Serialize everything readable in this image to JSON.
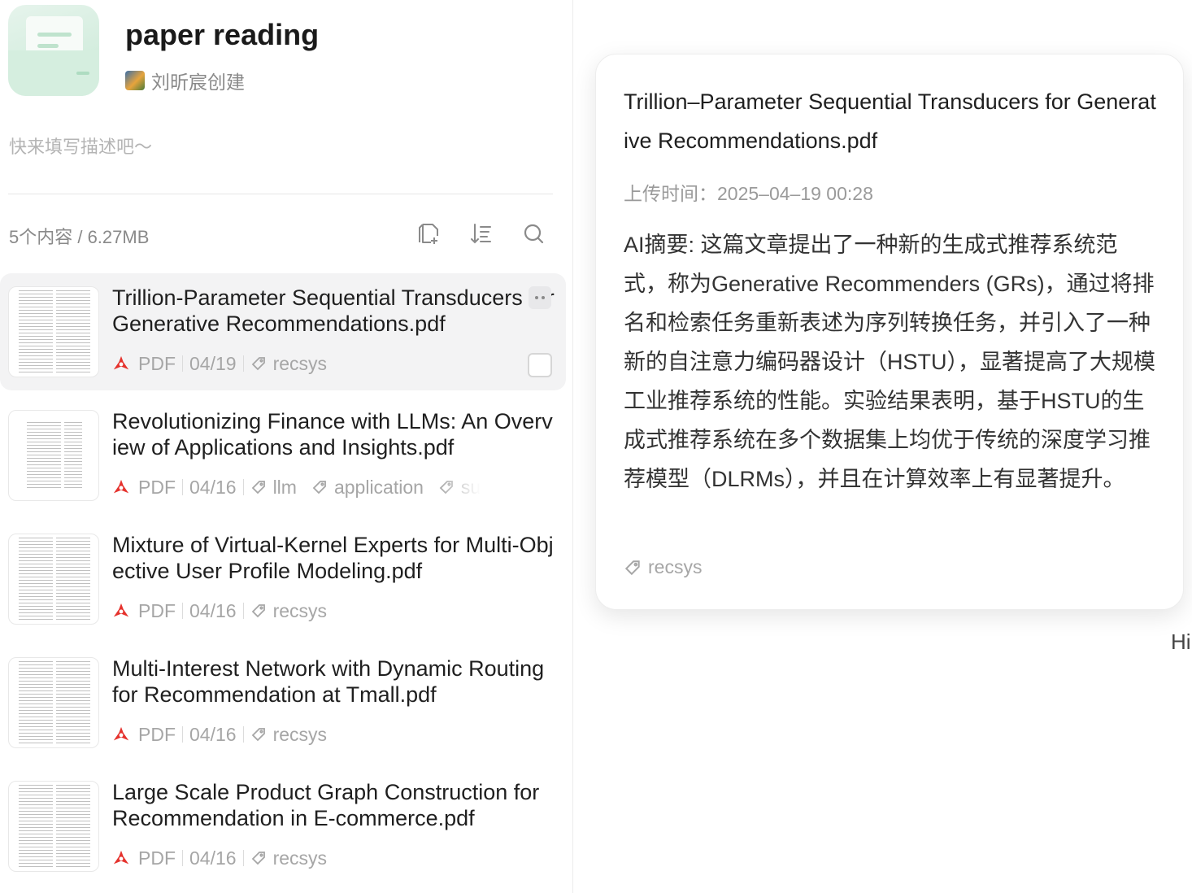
{
  "kb": {
    "title": "paper reading",
    "creator": "刘昕宸创建",
    "description": "快来填写描述吧～",
    "count": "5个内容 / 6.27MB"
  },
  "toolbar": {
    "icons": [
      "add-file-icon",
      "sort-icon",
      "search-icon"
    ]
  },
  "items": [
    {
      "title": "Trillion-Parameter Sequential Transducers for Generative Recommendations.pdf",
      "type": "PDF",
      "date": "04/19",
      "tags": [
        "recsys"
      ]
    },
    {
      "title": "Revolutionizing Finance with LLMs: An Overview of Applications and Insights.pdf",
      "type": "PDF",
      "date": "04/16",
      "tags": [
        "llm",
        "application",
        "su"
      ]
    },
    {
      "title": "Mixture of Virtual-Kernel Experts for Multi-Objective User Profile Modeling.pdf",
      "type": "PDF",
      "date": "04/16",
      "tags": [
        "recsys"
      ]
    },
    {
      "title": "Multi-Interest Network with Dynamic Routing for Recommendation at Tmall.pdf",
      "type": "PDF",
      "date": "04/16",
      "tags": [
        "recsys"
      ]
    },
    {
      "title": "Large Scale Product Graph Construction for Recommendation in E-commerce.pdf",
      "type": "PDF",
      "date": "04/16",
      "tags": [
        "recsys"
      ]
    }
  ],
  "preview": {
    "title": "Trillion–Parameter Sequential Transducers for Generative Recommendations.pdf",
    "upload_time": "上传时间：2025–04–19 00:28",
    "summary": "AI摘要: 这篇文章提出了一种新的生成式推荐系统范式，称为Generative Recommenders (GRs)，通过将排名和检索任务重新表述为序列转换任务，并引入了一种新的自注意力编码器设计（HSTU），显著提高了大规模工业推荐系统的性能。实验结果表明，基于HSTU的生成式推荐系统在多个数据集上均优于传统的深度学习推荐模型（DLRMs），并且在计算效率上有显著提升。",
    "tag": "recsys"
  },
  "edge_text": "Hi",
  "colors": {
    "pdf": "#e5322d",
    "muted": "#a6a6a6",
    "active_bg": "#f3f3f4"
  }
}
